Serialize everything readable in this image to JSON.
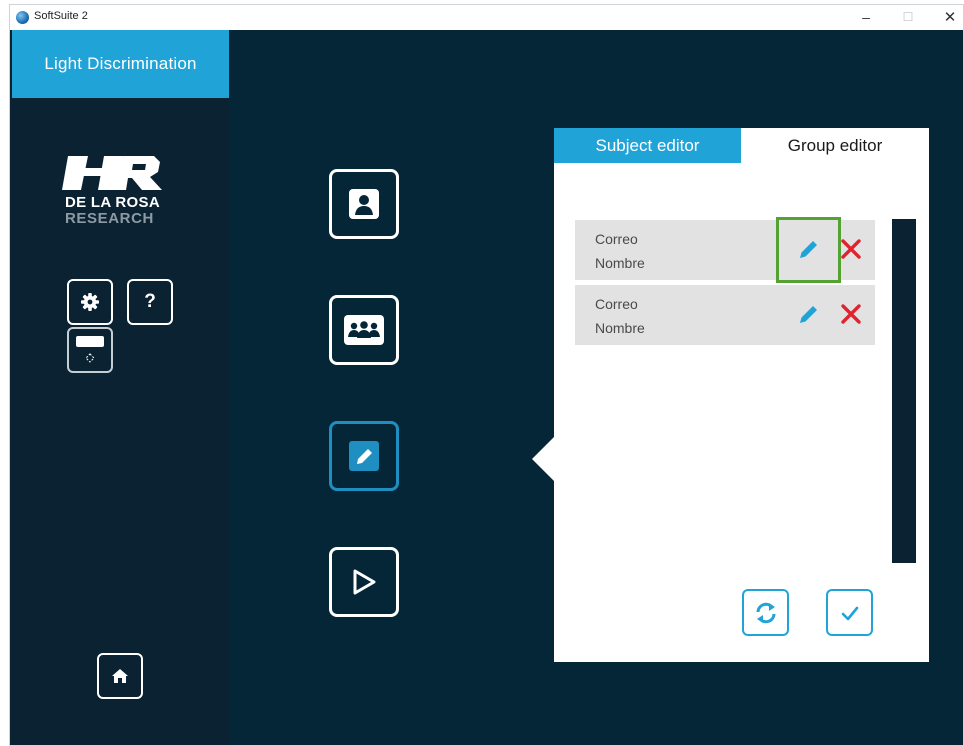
{
  "window": {
    "title": "SoftSuite 2",
    "controls": {
      "minimize": "–",
      "maximize": "☐",
      "close": "✕"
    }
  },
  "sidebar": {
    "app_title": "Light Discrimination",
    "logo": {
      "line1": "DE LA ROSA",
      "line2": "RESEARCH"
    },
    "buttons": {
      "settings_icon": "gear-icon",
      "help_label": "?",
      "display_icon": "display-icon",
      "home_icon": "home-icon"
    }
  },
  "nav": {
    "items": [
      {
        "icon": "subject-icon"
      },
      {
        "icon": "group-icon"
      },
      {
        "icon": "pencil-icon",
        "active": true
      },
      {
        "icon": "play-icon"
      }
    ]
  },
  "panel": {
    "tabs": [
      {
        "label": "Subject editor",
        "active": false
      },
      {
        "label": "Group editor",
        "active": true
      }
    ],
    "rows": [
      {
        "correo": "Correo",
        "nombre": "Nombre"
      },
      {
        "correo": "Correo",
        "nombre": "Nombre"
      }
    ]
  },
  "colors": {
    "accent": "#20a4d8",
    "sidebar_bg": "#0a2232",
    "main_bg": "#042636",
    "delete": "#e0242f",
    "highlight": "#53a233"
  }
}
